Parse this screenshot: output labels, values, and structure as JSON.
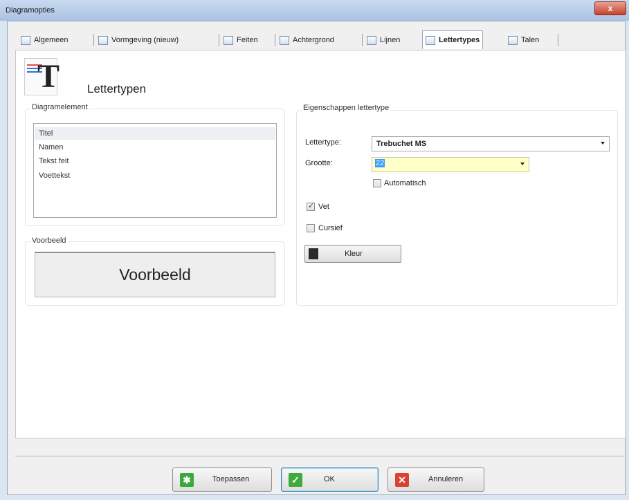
{
  "window": {
    "title": "Diagramopties",
    "close_label": "x"
  },
  "tabs": [
    {
      "label": "Algemeen",
      "icon": "general-icon"
    },
    {
      "label": "Vormgeving (nieuw)",
      "icon": "layout-icon"
    },
    {
      "label": "Feiten",
      "icon": "facts-icon"
    },
    {
      "label": "Achtergrond",
      "icon": "background-icon"
    },
    {
      "label": "Lijnen",
      "icon": "lines-icon"
    },
    {
      "label": "Lettertypes",
      "icon": "font-icon",
      "active": true
    },
    {
      "label": "Talen",
      "icon": "languages-icon"
    }
  ],
  "page": {
    "title": "Lettertypen",
    "icon": "font-header-icon"
  },
  "diagram_element": {
    "label": "Diagramelement",
    "items": [
      "Titel",
      "Namen",
      "Tekst feit",
      "Voettekst"
    ],
    "selected_index": 0
  },
  "preview": {
    "label": "Voorbeeld",
    "sample_text": "Voorbeeld"
  },
  "font_properties": {
    "label": "Eigenschappen lettertype",
    "font_label": "Lettertype:",
    "font_value": "Trebuchet MS",
    "size_label": "Grootte:",
    "size_value": "22",
    "automatic_label": "Automatisch",
    "automatic_checked": false,
    "bold_label": "Vet",
    "bold_checked": true,
    "italic_label": "Cursief",
    "italic_checked": false,
    "color_button_label": "Kleur",
    "color_value": "#2b2b2b"
  },
  "footer": {
    "apply_label": "Toepassen",
    "ok_label": "OK",
    "cancel_label": "Annuleren"
  },
  "colors": {
    "apply_icon": "#3aa83a",
    "ok_icon": "#3faa3f",
    "cancel_icon": "#d9432f",
    "size_field_highlight": "#ffffc8"
  }
}
